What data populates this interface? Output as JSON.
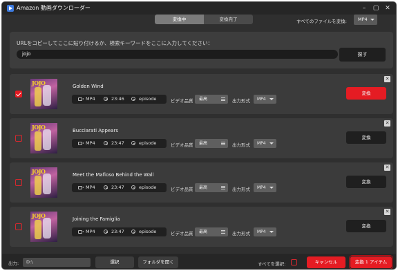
{
  "app": {
    "title": "Amazon 動画ダウンローダー"
  },
  "tabs": [
    {
      "label": "変換中",
      "active": true
    },
    {
      "label": "変換完了",
      "active": false
    }
  ],
  "convert_all": {
    "label": "すべてのファイルを変換:",
    "value": "MP4"
  },
  "url": {
    "hint": "URLをコピーしてここに貼り付けるか、検索キーワードをここに入力してください：",
    "value": "jojo",
    "search_label": "探す"
  },
  "item_labels": {
    "quality": "ビデオ品質",
    "format": "出力形式",
    "convert": "変換"
  },
  "items": [
    {
      "title": "Golden Wind",
      "format": "MP4",
      "duration": "23:46",
      "type": "episode",
      "quality": "最高",
      "output": "MP4",
      "checked": true,
      "thumb_text": "JOJO"
    },
    {
      "title": "Bucciarati Appears",
      "format": "MP4",
      "duration": "23:47",
      "type": "episode",
      "quality": "最高",
      "output": "MP4",
      "checked": false,
      "thumb_text": "JOJO"
    },
    {
      "title": "Meet the Mafioso Behind the Wall",
      "format": "MP4",
      "duration": "23:47",
      "type": "episode",
      "quality": "最高",
      "output": "MP4",
      "checked": false,
      "thumb_text": "JOJO"
    },
    {
      "title": "Joining the Famiglia",
      "format": "MP4",
      "duration": "23:47",
      "type": "episode",
      "quality": "最高",
      "output": "MP4",
      "checked": false,
      "thumb_text": "JOJO"
    }
  ],
  "bottom": {
    "output_label": "出力:",
    "output_path": "D:\\",
    "select_label": "選択",
    "open_folder_label": "フォルダを開く",
    "select_all_label": "すべてを選択:",
    "cancel_label": "キャンセル",
    "convert_label": "変換 1 アイテム"
  },
  "colors": {
    "accent": "#e51c23",
    "background": "#2f2f2f",
    "panel": "#3b3b3b"
  }
}
